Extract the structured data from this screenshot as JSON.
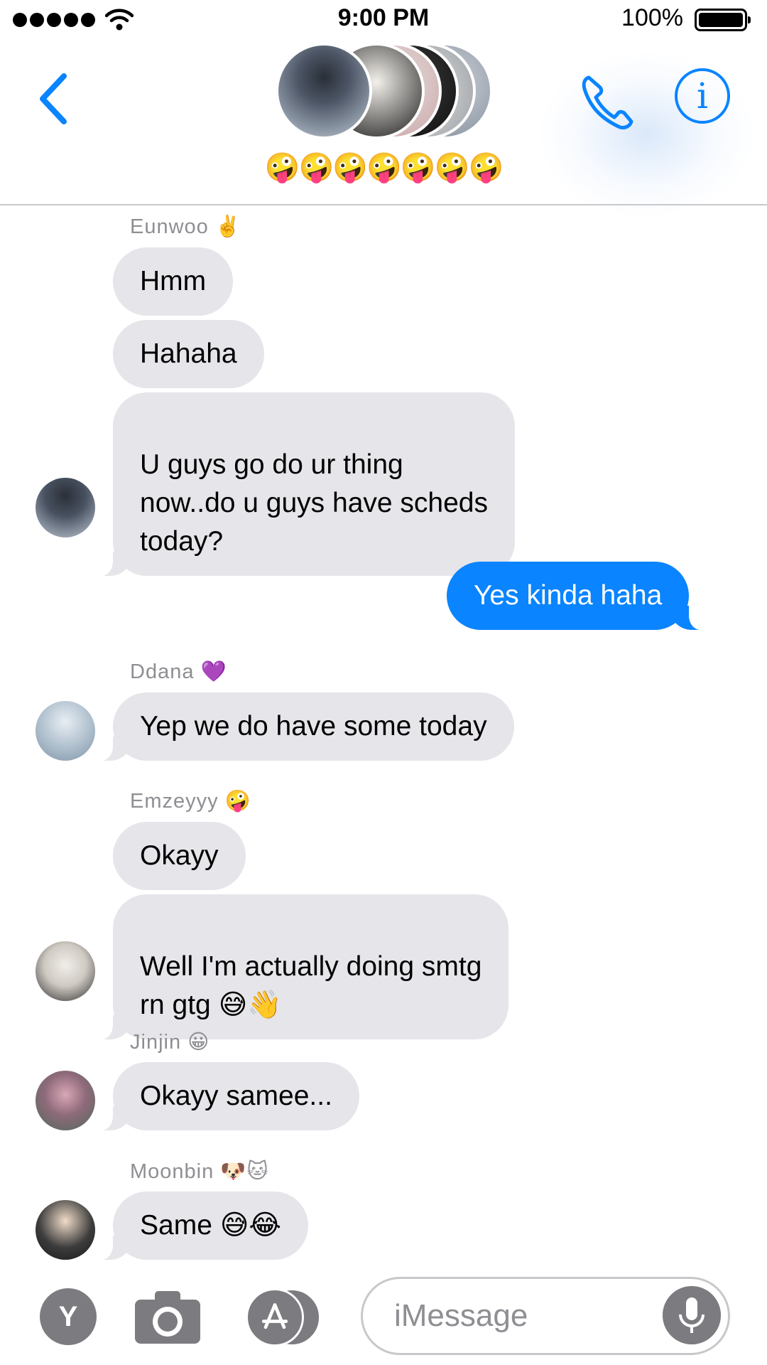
{
  "status_bar": {
    "time": "9:00 PM",
    "battery_percent": "100%",
    "battery_level": 1.0,
    "signal_bars": 5
  },
  "header": {
    "group_emoji": "🤪🤪🤪🤪🤪🤪🤪",
    "back_icon": "chevron-left-icon",
    "call_icon": "phone-icon",
    "info_icon": "info-icon",
    "info_glyph": "i"
  },
  "messages": [
    {
      "sender": "Eunwoo ✌️",
      "bubbles": [
        "Hmm",
        "Hahaha",
        "U guys go do ur thing\nnow..do u guys have scheds\ntoday?"
      ]
    },
    {
      "sent": "Yes kinda haha"
    },
    {
      "sender": "Ddana 💜",
      "bubbles": [
        "Yep we do have some today"
      ]
    },
    {
      "sender": "Emzeyyy 🤪",
      "bubbles": [
        "Okayy",
        "Well I'm actually doing smtg\nrn gtg 😅👋"
      ]
    },
    {
      "sender": "Jinjin 😀",
      "bubbles": [
        "Okayy samee..."
      ]
    },
    {
      "sender": "Moonbin 🐶🐱",
      "bubbles": [
        "Same 😅😂"
      ]
    }
  ],
  "input_bar": {
    "y_label": "Y",
    "placeholder": "iMessage",
    "value": ""
  },
  "colors": {
    "accent": "#0a84ff",
    "received_bubble": "#e5e5ea",
    "sent_bubble": "#0a84ff",
    "sender_text": "#8e8e93",
    "button_gray": "#7c7c80"
  }
}
